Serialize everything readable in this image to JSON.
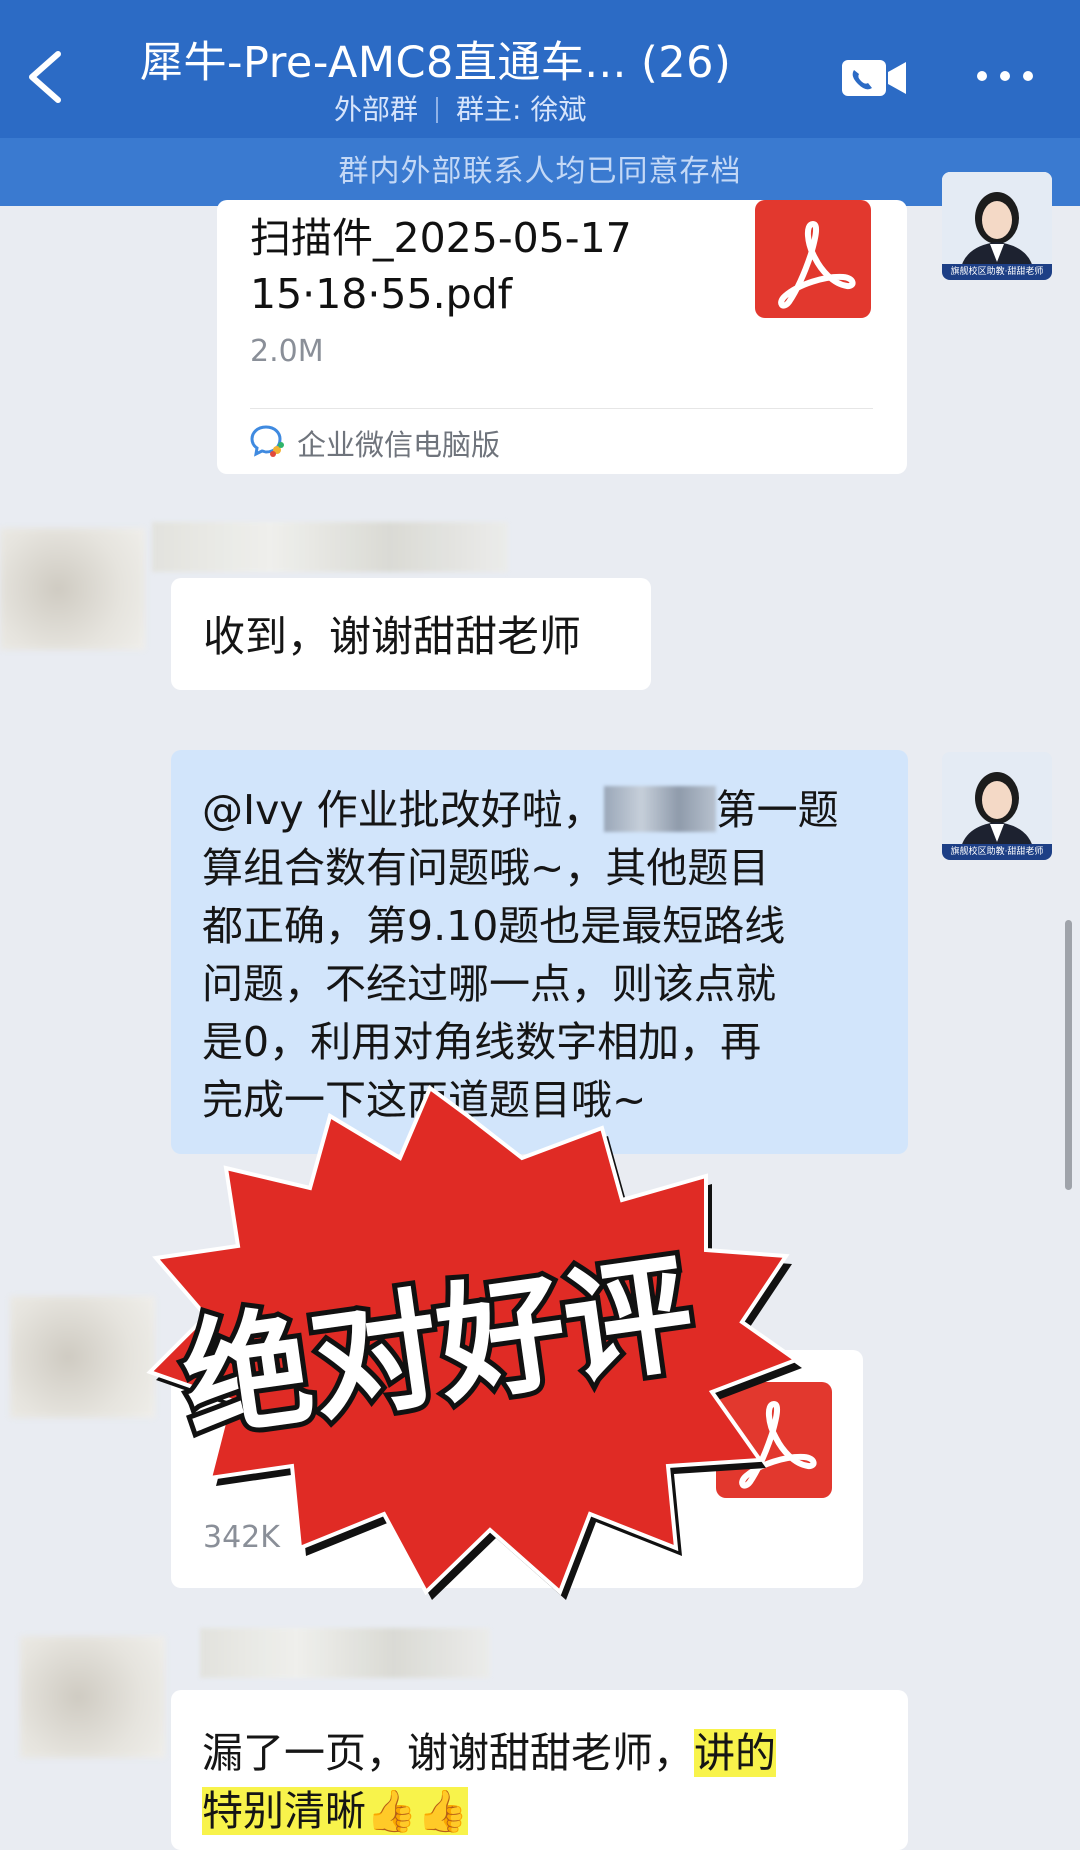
{
  "header": {
    "title": "犀牛-Pre-AMC8直通车... (26)",
    "group_type": "外部群",
    "owner": "群主: 徐斌",
    "notice": "群内外部联系人均已同意存档",
    "icons": [
      "back-arrow-icon",
      "video-call-icon",
      "more-icon"
    ]
  },
  "messages": {
    "file1": {
      "name_line1": "扫描件_2025-05-17",
      "name_line2": "15·18·55.pdf",
      "size": "2.0M",
      "source": "企业微信电脑版"
    },
    "reply1": "收到，谢谢甜甜老师",
    "teacher_msg": {
      "line1_a": "@Ivy 作业批改好啦，",
      "line1_b": "第一题",
      "line2": "算组合数有问题哦~，其他题目",
      "line3": "都正确，第9.10题也是最短路线",
      "line4": "问题，不经过哪一点，则该点就",
      "line5": "是0，利用对角线数字相加，再",
      "line6": "完成一下这两道题目哦~"
    },
    "file2": {
      "size": "342K"
    },
    "reply2": {
      "part1": "漏了一页，谢谢甜甜老师，",
      "highlight1": "讲的",
      "highlight2": "特别清晰",
      "emoji": "👍👍"
    }
  },
  "overlay": {
    "stamp_text": "绝对好评"
  },
  "avatar_caption": "旗舰校区助教·甜甜老师",
  "colors": {
    "header": "#2c6bc5",
    "notice_bar": "#3a7ad0",
    "teacher_bubble": "#d2e5fb",
    "pdf_red": "#e2382e",
    "burst_red": "#e02b25",
    "highlight": "#f8f34b"
  }
}
